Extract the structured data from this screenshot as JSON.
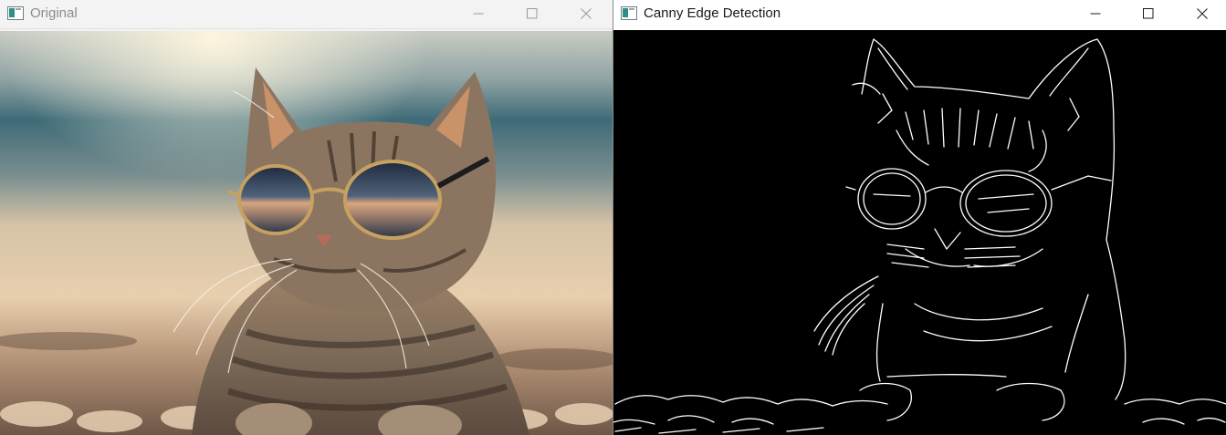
{
  "windows": {
    "original": {
      "title": "Original",
      "image_icon": "photo-canvas",
      "minimize_icon": "minimize-icon",
      "maximize_icon": "maximize-icon",
      "close_icon": "close-icon"
    },
    "canny": {
      "title": "Canny Edge Detection",
      "image_icon": "edge-map-canvas",
      "minimize_icon": "minimize-icon",
      "maximize_icon": "maximize-icon",
      "close_icon": "close-icon"
    }
  },
  "colors": {
    "edge_background": "#000000",
    "edge_lines": "#ffffff"
  }
}
